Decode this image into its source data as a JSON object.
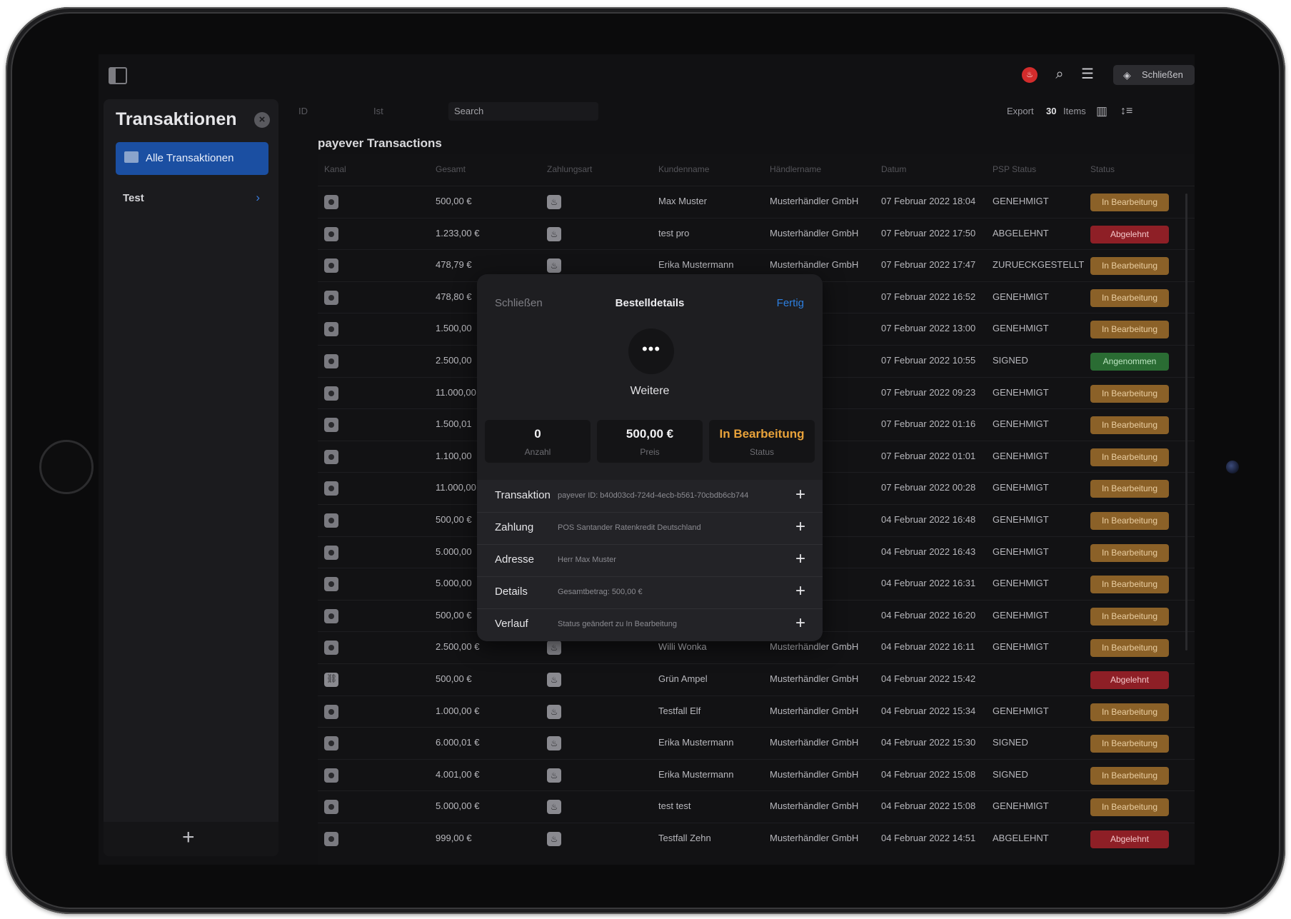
{
  "topbar": {
    "close_button": "Schließen"
  },
  "sidebar": {
    "title": "Transaktionen",
    "active_item": "Alle Transaktionen",
    "items": [
      {
        "label": "Test"
      }
    ]
  },
  "toolbar": {
    "id_placeholder": "ID",
    "ist_placeholder": "Ist",
    "search_placeholder": "Search",
    "export_label": "Export",
    "items_count": "30",
    "items_label": "Items"
  },
  "table": {
    "title": "payever Transactions",
    "columns": [
      "Kanal",
      "Gesamt",
      "Zahlungsart",
      "Kundenname",
      "Händlername",
      "Datum",
      "PSP Status",
      "Status"
    ],
    "rows": [
      {
        "total": "500,00 €",
        "customer": "Max Muster",
        "merchant": "Musterhändler GmbH",
        "date": "07 Februar 2022 18:04",
        "psp": "GENEHMIGT",
        "status": "In Bearbeitung",
        "status_kind": "proc",
        "channel": "default"
      },
      {
        "total": "1.233,00 €",
        "customer": "test pro",
        "merchant": "Musterhändler GmbH",
        "date": "07 Februar 2022 17:50",
        "psp": "ABGELEHNT",
        "status": "Abgelehnt",
        "status_kind": "rej",
        "channel": "default"
      },
      {
        "total": "478,79 €",
        "customer": "Erika Mustermann",
        "merchant": "Musterhändler GmbH",
        "date": "07 Februar 2022 17:47",
        "psp": "ZURUECKGESTELLT",
        "status": "In Bearbeitung",
        "status_kind": "proc",
        "channel": "default"
      },
      {
        "total": "478,80 €",
        "customer": "",
        "merchant": "ler GmbH",
        "date": "07 Februar 2022 16:52",
        "psp": "GENEHMIGT",
        "status": "In Bearbeitung",
        "status_kind": "proc",
        "channel": "default"
      },
      {
        "total": "1.500,00",
        "customer": "",
        "merchant": "ler GmbH",
        "date": "07 Februar 2022 13:00",
        "psp": "GENEHMIGT",
        "status": "In Bearbeitung",
        "status_kind": "proc",
        "channel": "default"
      },
      {
        "total": "2.500,00",
        "customer": "",
        "merchant": "ler GmbH",
        "date": "07 Februar 2022 10:55",
        "psp": "SIGNED",
        "status": "Angenommen",
        "status_kind": "acc",
        "channel": "default"
      },
      {
        "total": "11.000,00",
        "customer": "",
        "merchant": "ler GmbH",
        "date": "07 Februar 2022 09:23",
        "psp": "GENEHMIGT",
        "status": "In Bearbeitung",
        "status_kind": "proc",
        "channel": "default"
      },
      {
        "total": "1.500,01",
        "customer": "",
        "merchant": "ler GmbH",
        "date": "07 Februar 2022 01:16",
        "psp": "GENEHMIGT",
        "status": "In Bearbeitung",
        "status_kind": "proc",
        "channel": "default"
      },
      {
        "total": "1.100,00",
        "customer": "",
        "merchant": "ler GmbH",
        "date": "07 Februar 2022 01:01",
        "psp": "GENEHMIGT",
        "status": "In Bearbeitung",
        "status_kind": "proc",
        "channel": "default"
      },
      {
        "total": "11.000,00",
        "customer": "",
        "merchant": "ler GmbH",
        "date": "07 Februar 2022 00:28",
        "psp": "GENEHMIGT",
        "status": "In Bearbeitung",
        "status_kind": "proc",
        "channel": "default"
      },
      {
        "total": "500,00 €",
        "customer": "",
        "merchant": "ler GmbH",
        "date": "04 Februar 2022 16:48",
        "psp": "GENEHMIGT",
        "status": "In Bearbeitung",
        "status_kind": "proc",
        "channel": "default"
      },
      {
        "total": "5.000,00",
        "customer": "",
        "merchant": "ler GmbH",
        "date": "04 Februar 2022 16:43",
        "psp": "GENEHMIGT",
        "status": "In Bearbeitung",
        "status_kind": "proc",
        "channel": "default"
      },
      {
        "total": "5.000,00",
        "customer": "",
        "merchant": "ler GmbH",
        "date": "04 Februar 2022 16:31",
        "psp": "GENEHMIGT",
        "status": "In Bearbeitung",
        "status_kind": "proc",
        "channel": "default"
      },
      {
        "total": "500,00 €",
        "customer": "",
        "merchant": "ler GmbH",
        "date": "04 Februar 2022 16:20",
        "psp": "GENEHMIGT",
        "status": "In Bearbeitung",
        "status_kind": "proc",
        "channel": "default"
      },
      {
        "total": "2.500,00 €",
        "customer": "Willi Wonka",
        "merchant": "Musterhändler GmbH",
        "date": "04 Februar 2022 16:11",
        "psp": "GENEHMIGT",
        "status": "In Bearbeitung",
        "status_kind": "proc",
        "channel": "default"
      },
      {
        "total": "500,00 €",
        "customer": "Grün Ampel",
        "merchant": "Musterhändler GmbH",
        "date": "04 Februar 2022 15:42",
        "psp": "",
        "status": "Abgelehnt",
        "status_kind": "rej",
        "channel": "link"
      },
      {
        "total": "1.000,00 €",
        "customer": "Testfall Elf",
        "merchant": "Musterhändler GmbH",
        "date": "04 Februar 2022 15:34",
        "psp": "GENEHMIGT",
        "status": "In Bearbeitung",
        "status_kind": "proc",
        "channel": "default"
      },
      {
        "total": "6.000,01 €",
        "customer": "Erika Mustermann",
        "merchant": "Musterhändler GmbH",
        "date": "04 Februar 2022 15:30",
        "psp": "SIGNED",
        "status": "In Bearbeitung",
        "status_kind": "proc",
        "channel": "default"
      },
      {
        "total": "4.001,00 €",
        "customer": "Erika Mustermann",
        "merchant": "Musterhändler GmbH",
        "date": "04 Februar 2022 15:08",
        "psp": "SIGNED",
        "status": "In Bearbeitung",
        "status_kind": "proc",
        "channel": "default"
      },
      {
        "total": "5.000,00 €",
        "customer": "test test",
        "merchant": "Musterhändler GmbH",
        "date": "04 Februar 2022 15:08",
        "psp": "GENEHMIGT",
        "status": "In Bearbeitung",
        "status_kind": "proc",
        "channel": "default"
      },
      {
        "total": "999,00 €",
        "customer": "Testfall Zehn",
        "merchant": "Musterhändler GmbH",
        "date": "04 Februar 2022 14:51",
        "psp": "ABGELEHNT",
        "status": "Abgelehnt",
        "status_kind": "rej",
        "channel": "default"
      }
    ]
  },
  "modal": {
    "close_label": "Schließen",
    "title": "Bestelldetails",
    "done_label": "Fertig",
    "avatar_text": "•••",
    "name": "Weitere",
    "stats": [
      {
        "value": "0",
        "label": "Anzahl"
      },
      {
        "value": "500,00 €",
        "label": "Preis"
      },
      {
        "value": "In Bearbeitung",
        "label": "Status"
      }
    ],
    "sections": [
      {
        "key": "Transaktion",
        "value": "payever ID: b40d03cd-724d-4ecb-b561-70cbdb6cb744"
      },
      {
        "key": "Zahlung",
        "value": "POS Santander Ratenkredit Deutschland"
      },
      {
        "key": "Adresse",
        "value": "Herr Max Muster"
      },
      {
        "key": "Details",
        "value": "Gesamtbetrag: 500,00 €"
      },
      {
        "key": "Verlauf",
        "value": "Status geändert zu In Bearbeitung"
      }
    ]
  },
  "colors": {
    "accent_blue": "#2d7fe0",
    "status_processing": "#8b6128",
    "status_rejected": "#8e1f26",
    "status_accepted": "#2a6c33",
    "status_text_orange": "#e8a23a"
  },
  "icons": {
    "sidebar_toggle": "sidebar-toggle-icon",
    "logo": "payever-logo-icon",
    "search": "search-icon",
    "menu": "menu-icon",
    "layers": "layers-icon",
    "close_circle": "close-circle-icon",
    "folder": "folder-icon",
    "chevron": "chevron-right-icon",
    "add": "plus-icon",
    "columns": "columns-icon",
    "sort": "sort-icon"
  }
}
